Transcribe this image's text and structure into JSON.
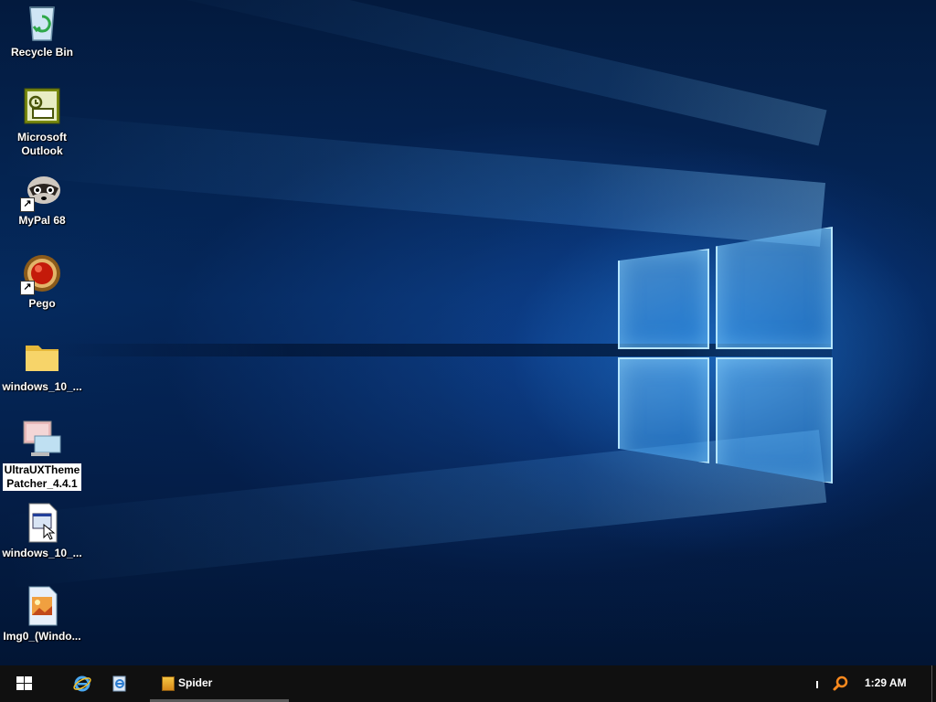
{
  "desktop": {
    "icons": [
      {
        "label": "Recycle Bin",
        "icon": "recycle-bin-icon",
        "selected": false
      },
      {
        "label": "Microsoft\nOutlook",
        "icon": "outlook-icon",
        "selected": false
      },
      {
        "label": "MyPal 68",
        "icon": "mypal-raccoon-icon",
        "selected": false
      },
      {
        "label": "Pego",
        "icon": "pego-red-ball-icon",
        "selected": false
      },
      {
        "label": "windows_10_...",
        "icon": "folder-icon",
        "selected": false
      },
      {
        "label": "UltraUXTheme\nPatcher_4.4.1",
        "icon": "computer-monitor-icon",
        "selected": true
      },
      {
        "label": "windows_10_...",
        "icon": "msstyles-file-icon",
        "selected": false
      },
      {
        "label": "Img0_(Windo...",
        "icon": "image-file-icon",
        "selected": false
      }
    ]
  },
  "taskbar": {
    "start_icon": "windows-logo-icon",
    "quick_launch": [
      {
        "icon": "internet-explorer-icon"
      },
      {
        "icon": "document-e-icon"
      }
    ],
    "task_buttons": [
      {
        "label": "Spider",
        "icon": "spider-solitaire-icon"
      }
    ],
    "tray": {
      "search_icon": "search-magnifier-icon"
    },
    "clock": "1:29 AM"
  },
  "colors": {
    "taskbar_bg": "#101010",
    "desktop_bg": "#04204c",
    "logo_glow": "#6cc4ff",
    "selected_label_bg": "#ffffff"
  }
}
